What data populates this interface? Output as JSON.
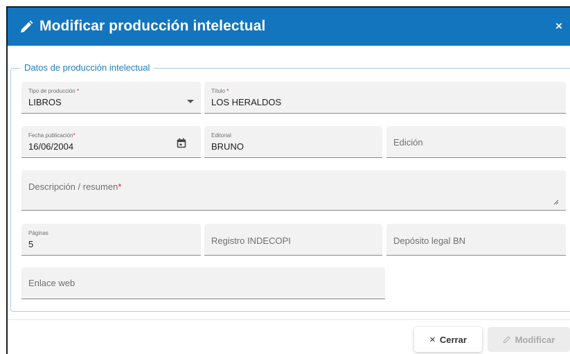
{
  "dialog": {
    "title": "Modificar producción intelectual",
    "close_glyph": "×"
  },
  "section": {
    "legend": "Datos de producción intelectual"
  },
  "fields": {
    "tipo": {
      "label": "Tipo de producción",
      "required_mark": "*",
      "value": "LIBROS"
    },
    "titulo": {
      "label": "Título",
      "required_mark": "*",
      "value": "LOS HERALDOS"
    },
    "fecha": {
      "label": "Fecha publicación",
      "required_mark": "*",
      "value": "16/06/2004"
    },
    "editorial": {
      "label": "Editorial",
      "value": "BRUNO"
    },
    "edicion": {
      "placeholder": "Edición"
    },
    "descripcion": {
      "placeholder": "Descripción / resumen",
      "required_mark": "*"
    },
    "paginas": {
      "label": "Páginas",
      "value": "5"
    },
    "indecopi": {
      "placeholder": "Registro INDECOPI"
    },
    "deposito": {
      "placeholder": "Depósito legal BN"
    },
    "enlace": {
      "placeholder": "Enlace web"
    }
  },
  "buttons": {
    "cerrar": {
      "label": "Cerrar",
      "glyph": "×"
    },
    "modificar": {
      "label": "Modificar"
    }
  },
  "icons": {
    "header": "pencil-icon",
    "date": "calendar-icon",
    "select": "dropdown-arrow-icon",
    "textarea": "resize-handle-icon"
  },
  "colors": {
    "header_bg": "#1275be",
    "accent": "#1c7dc4",
    "required": "#e0203a",
    "field_bg": "#f2f2f2",
    "disabled_text": "#a8a8a8"
  }
}
